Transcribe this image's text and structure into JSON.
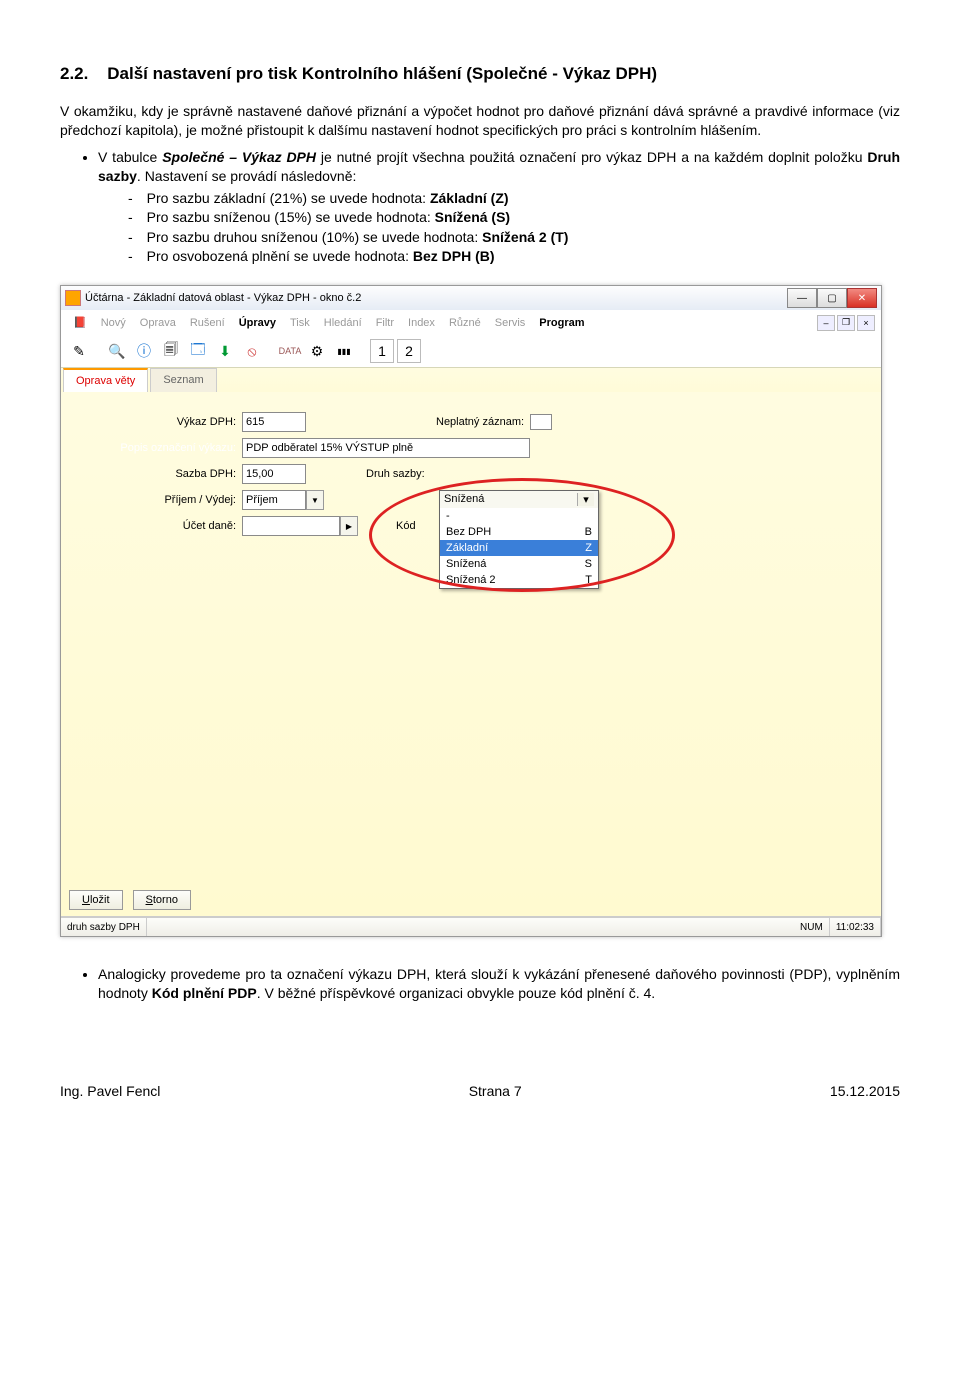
{
  "section": {
    "num": "2.2.",
    "title": "Další nastavení pro tisk Kontrolního hlášení (Společné - Výkaz DPH)"
  },
  "intro": "V okamžiku, kdy je správně nastavené daňové přiznání a výpočet hodnot pro daňové přiznání dává správné a pravdivé informace (viz předchozí kapitola), je možné přistoupit k dalšímu nastavení hodnot specifických pro práci s kontrolním hlášením.",
  "bullet1_pre": "V tabulce ",
  "bullet1_bi": "Společné – Výkaz DPH",
  "bullet1_mid": " je nutné projít všechna použitá označení pro výkaz DPH a na každém doplnit položku ",
  "bullet1_b": "Druh sazby",
  "bullet1_post": ". Nastavení se provádí následovně:",
  "sub1_a": "Pro sazbu základní (21%) se uvede hodnota: ",
  "sub1_b": "Základní (Z)",
  "sub2_a": "Pro sazbu sníženou (15%) se uvede hodnota: ",
  "sub2_b": "Snížená (S)",
  "sub3_a": "Pro sazbu druhou sníženou (10%) se uvede hodnota: ",
  "sub3_b": "Snížená 2 (T)",
  "sub4_a": "Pro osvobozená plnění se uvede hodnota: ",
  "sub4_b": "Bez DPH (B)",
  "window_title": "Účtárna - Základní datová oblast - Výkaz DPH - okno č.2",
  "menu": {
    "novy": "Nový",
    "oprava": "Oprava",
    "ruseni": "Rušení",
    "upravy": "Úpravy",
    "tisk": "Tisk",
    "hledani": "Hledání",
    "filtr": "Filtr",
    "index": "Index",
    "ruzne": "Různé",
    "servis": "Servis",
    "program": "Program"
  },
  "tabs": {
    "active": "Oprava věty",
    "inactive": "Seznam"
  },
  "fields": {
    "vykaz_dph_label": "Výkaz DPH:",
    "vykaz_dph_value": "615",
    "neplatny_label": "Neplatný záznam:",
    "popis_label": "Popis označení výkazu:",
    "popis_value": "PDP odběratel 15% VÝSTUP plně",
    "sazba_label": "Sazba DPH:",
    "sazba_value": "15,00",
    "druh_label": "Druh sazby:",
    "druh_selected": "Snížená",
    "prijem_label": "Příjem / Výdej:",
    "prijem_value": "Příjem",
    "ucet_label": "Účet daně:",
    "kod_label": "Kód"
  },
  "dropdown": {
    "r0_l": "-",
    "r0_r": "",
    "r1_l": "Bez DPH",
    "r1_r": "B",
    "r2_l": "Základní",
    "r2_r": "Z",
    "r3_l": "Snížená",
    "r3_r": "S",
    "r4_l": "Snížená 2",
    "r4_r": "T"
  },
  "buttons": {
    "ulozit": "Uložit",
    "storno": "Storno"
  },
  "status": {
    "left": "druh sazby DPH",
    "num": "NUM",
    "time": "11:02:33"
  },
  "outro_a": "Analogicky provedeme pro ta označení výkazu DPH, která slouží k vykázání přenesené daňového povinnosti (PDP), vyplněním hodnoty ",
  "outro_b": "Kód plnění PDP",
  "outro_c": ". V běžné příspěvkové organizaci obvykle pouze kód plnění č. 4.",
  "footer": {
    "left": "Ing. Pavel Fencl",
    "mid": "Strana 7",
    "right": "15.12.2015"
  }
}
